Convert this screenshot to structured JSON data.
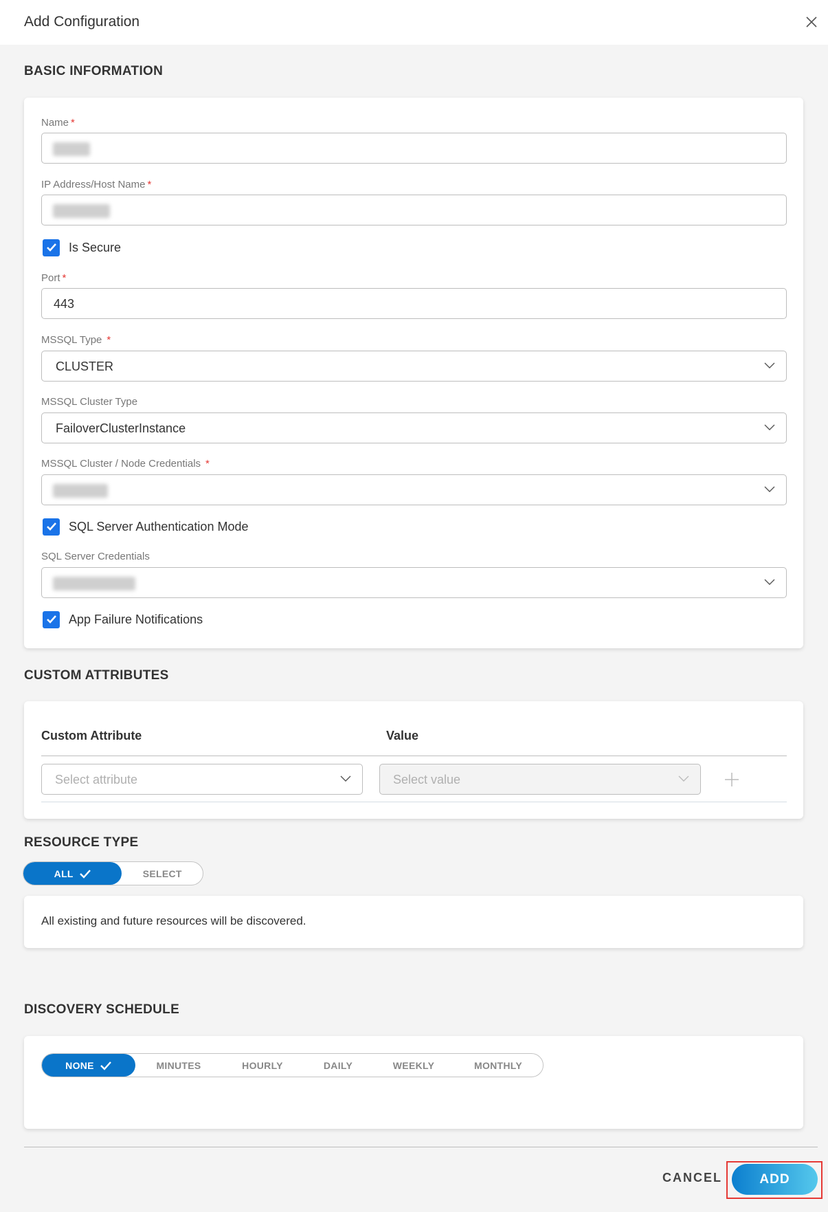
{
  "header": {
    "title": "Add Configuration",
    "close_icon": "close-icon"
  },
  "basic": {
    "section_title": "BASIC INFORMATION",
    "name": {
      "label": "Name",
      "required": "*",
      "value_redacted": true
    },
    "host": {
      "label": "IP Address/Host Name",
      "required": "*",
      "value_redacted": true
    },
    "is_secure": {
      "label": "Is Secure",
      "checked": true
    },
    "port": {
      "label": "Port",
      "required": "*",
      "value": "443"
    },
    "mssql_type": {
      "label": "MSSQL Type",
      "required": "*",
      "value": "CLUSTER"
    },
    "cluster_type": {
      "label": "MSSQL Cluster Type",
      "value": "FailoverClusterInstance"
    },
    "node_creds": {
      "label": "MSSQL Cluster / Node Credentials",
      "required": "*",
      "value_redacted": true
    },
    "sql_auth": {
      "label": "SQL Server Authentication Mode",
      "checked": true
    },
    "sql_creds": {
      "label": "SQL Server Credentials",
      "value_redacted": true
    },
    "app_failure": {
      "label": "App Failure Notifications",
      "checked": true
    }
  },
  "custom": {
    "section_title": "CUSTOM ATTRIBUTES",
    "col_attribute": "Custom Attribute",
    "col_value": "Value",
    "attribute_placeholder": "Select attribute",
    "value_placeholder": "Select value",
    "add_icon": "plus-icon"
  },
  "resource": {
    "section_title": "RESOURCE TYPE",
    "options": [
      "ALL",
      "SELECT"
    ],
    "selected": "ALL",
    "info": "All existing and future resources will be discovered."
  },
  "schedule": {
    "section_title": "DISCOVERY SCHEDULE",
    "options": [
      "NONE",
      "MINUTES",
      "HOURLY",
      "DAILY",
      "WEEKLY",
      "MONTHLY"
    ],
    "selected": "NONE"
  },
  "footer": {
    "cancel": "CANCEL",
    "add": "ADD"
  },
  "colors": {
    "primary": "#0a75c9",
    "checkbox": "#1a73e8",
    "required": "#e53935",
    "highlight": "#e53935"
  }
}
